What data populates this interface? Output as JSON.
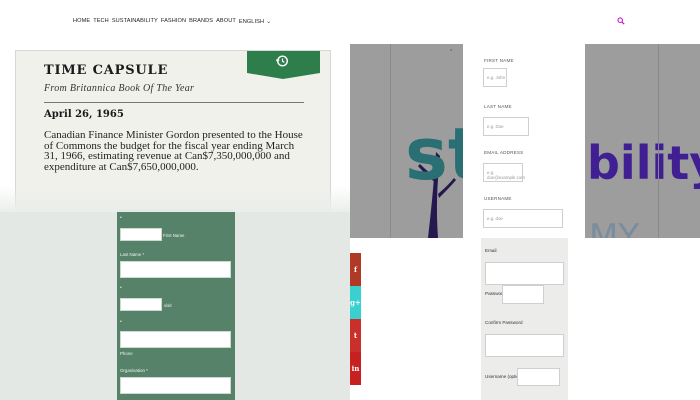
{
  "nav": {
    "items": [
      "HOME",
      "TECH",
      "SUSTAINABILITY",
      "FASHION",
      "BRANDS",
      "ABOUT",
      "ENGLISH"
    ],
    "search_icon": "search-icon"
  },
  "capsule": {
    "title": "TIME CAPSULE",
    "subtitle": "From Britannica Book Of The Year",
    "date": "April 26, 1965",
    "body": "Canadian Finance Minister Gordon presented to the House of Commons the budget for the fiscal year ending March 31, 1966, estimating revenue at Can$7,350,000,000 and expenditure at Can$7,650,000,000.",
    "tab_icon": "history-icon",
    "tab_color": "#2e7e4c"
  },
  "green_form": {
    "first_name_label": "First Name",
    "last_name_label": "Last Name *",
    "visit_label": "visit",
    "phone_label": "Phone",
    "org_label": "Organisation *",
    "bg_color": "#56826a"
  },
  "social": {
    "facebook": "f",
    "googleplus": "g+",
    "twitter": "t",
    "linkedin": "in"
  },
  "logo": {
    "left_text": "sta",
    "right_text": "bility",
    "right_sub": "MY",
    "tree_color": "#25184f",
    "text_color": "#2a6f73"
  },
  "signup": {
    "first_name_label": "FIRST NAME",
    "first_name_placeholder": "e.g. John",
    "last_name_label": "LAST NAME",
    "last_name_placeholder": "e.g. Doe",
    "email_label": "EMAIL ADDRESS",
    "email_placeholder": "e.g. doe@example.com",
    "username_label": "USERNAME",
    "username_placeholder": "e.g. doe"
  },
  "register": {
    "email_label": "Email",
    "password_label": "Password",
    "confirm_label": "Confirm Password",
    "username_label": "Username (optional)"
  }
}
